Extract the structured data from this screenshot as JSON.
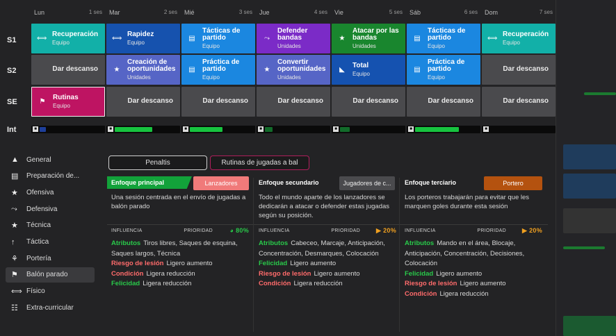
{
  "colors": {
    "teal": "#12b0a8",
    "blue": "#1b87e0",
    "purple": "#7b2bc7",
    "green": "#19862e",
    "dark_blue": "#1552b0",
    "slate": "#5665c6",
    "magenta": "#be1462",
    "rest": "#4a4a4d",
    "bar_green": "#17c33f",
    "bar_blue": "#1e3f9a"
  },
  "days": [
    {
      "name": "Lun",
      "session": "1 ses"
    },
    {
      "name": "Mar",
      "session": "2 ses"
    },
    {
      "name": "Mié",
      "session": "3 ses"
    },
    {
      "name": "Jue",
      "session": "4 ses"
    },
    {
      "name": "Vie",
      "session": "5 ses"
    },
    {
      "name": "Sáb",
      "session": "6 ses"
    },
    {
      "name": "Dom",
      "session": "7 ses"
    }
  ],
  "rows": [
    "S1",
    "S2",
    "SE",
    "Int"
  ],
  "schedule": {
    "s1": [
      {
        "title": "Recuperación",
        "sub": "Equipo",
        "icon": "dumbbell-icon"
      },
      {
        "title": "Rapidez",
        "sub": "Equipo",
        "icon": "dumbbell-icon"
      },
      {
        "title": "Tácticas de partido",
        "sub": "Equipo",
        "icon": "clipboard-icon"
      },
      {
        "title": "Defender bandas",
        "sub": "Unidades",
        "icon": "slide-tackle-icon"
      },
      {
        "title": "Atacar por las bandas",
        "sub": "Unidades",
        "icon": "running-icon"
      },
      {
        "title": "Tácticas de partido",
        "sub": "Equipo",
        "icon": "clipboard-icon"
      },
      {
        "title": "Recuperación",
        "sub": "Equipo",
        "icon": "dumbbell-icon"
      }
    ],
    "s2": [
      {
        "title": "Dar descanso",
        "sub": ""
      },
      {
        "title": "Creación de oportunidades",
        "sub": "Unidades",
        "icon": "running-icon"
      },
      {
        "title": "Práctica de partido",
        "sub": "Equipo",
        "icon": "clipboard-icon"
      },
      {
        "title": "Convertir oportunidades",
        "sub": "Unidades",
        "icon": "running-icon"
      },
      {
        "title": "Total",
        "sub": "Equipo",
        "icon": "boot-icon"
      },
      {
        "title": "Práctica de partido",
        "sub": "Equipo",
        "icon": "clipboard-icon"
      },
      {
        "title": "Dar descanso",
        "sub": ""
      }
    ],
    "se": [
      {
        "title": "Rutinas",
        "sub": "Equipo",
        "icon": "flag-icon"
      },
      {
        "title": "Dar descanso",
        "sub": ""
      },
      {
        "title": "Dar descanso",
        "sub": ""
      },
      {
        "title": "Dar descanso",
        "sub": ""
      },
      {
        "title": "Dar descanso",
        "sub": ""
      },
      {
        "title": "Dar descanso",
        "sub": ""
      },
      {
        "title": "Dar descanso",
        "sub": ""
      }
    ],
    "intensity": [
      0.1,
      0.6,
      0.52,
      0.12,
      0.15,
      0.7,
      0.0
    ]
  },
  "sidebar": {
    "items": [
      {
        "label": "General",
        "icon": "cone-icon"
      },
      {
        "label": "Preparación de...",
        "icon": "clipboard-icon"
      },
      {
        "label": "Ofensiva",
        "icon": "running-icon"
      },
      {
        "label": "Defensiva",
        "icon": "slide-tackle-icon"
      },
      {
        "label": "Técnica",
        "icon": "running-icon"
      },
      {
        "label": "Táctica",
        "icon": "tactics-icon"
      },
      {
        "label": "Portería",
        "icon": "goalkeeper-icon"
      },
      {
        "label": "Balón parado",
        "icon": "flag-icon"
      },
      {
        "label": "Físico",
        "icon": "dumbbell-icon"
      },
      {
        "label": "Extra-curricular",
        "icon": "team-icon"
      }
    ]
  },
  "tabs": [
    {
      "label": "Penaltis"
    },
    {
      "label": "Rutinas de jugadas a bal"
    }
  ],
  "focus": [
    {
      "label": "Enfoque principal",
      "button": "Lanzadores",
      "description": "Una sesión centrada en el envío de jugadas a balón parado",
      "influence_label": "INFLUENCIA",
      "priority_label": "PRIORIDAD",
      "priority_value": "80%",
      "effects": [
        {
          "key": "Atributos",
          "value": "Tiros libres, Saques de esquina, Saques largos, Técnica"
        },
        {
          "key": "Riesgo de lesión",
          "value": "Ligero aumento"
        },
        {
          "key": "Condición",
          "value": "Ligera reducción"
        },
        {
          "key": "Felicidad",
          "value": "Ligera reducción"
        }
      ]
    },
    {
      "label": "Enfoque secundario",
      "button": "Jugadores de c...",
      "description": "Todo el mundo aparte de los lanzadores se dedicarán a atacar o defender estas jugadas según su posición.",
      "influence_label": "INFLUENCIA",
      "priority_label": "PRIORIDAD",
      "priority_value": "20%",
      "effects": [
        {
          "key": "Atributos",
          "value": "Cabeceo, Marcaje, Anticipación, Concentración, Desmarques, Colocación"
        },
        {
          "key": "Felicidad",
          "value": "Ligero aumento"
        },
        {
          "key": "Riesgo de lesión",
          "value": "Ligero aumento"
        },
        {
          "key": "Condición",
          "value": "Ligera reducción"
        }
      ]
    },
    {
      "label": "Enfoque terciario",
      "button": "Portero",
      "description": "Los porteros trabajarán para evitar que les marquen goles durante esta sesión",
      "influence_label": "INFLUENCIA",
      "priority_label": "PRIORIDAD",
      "priority_value": "20%",
      "effects": [
        {
          "key": "Atributos",
          "value": "Mando en el área, Blocaje, Anticipación, Concentración, Decisiones, Colocación"
        },
        {
          "key": "Felicidad",
          "value": "Ligero aumento"
        },
        {
          "key": "Riesgo de lesión",
          "value": "Ligero aumento"
        },
        {
          "key": "Condición",
          "value": "Ligera reducción"
        }
      ]
    }
  ]
}
